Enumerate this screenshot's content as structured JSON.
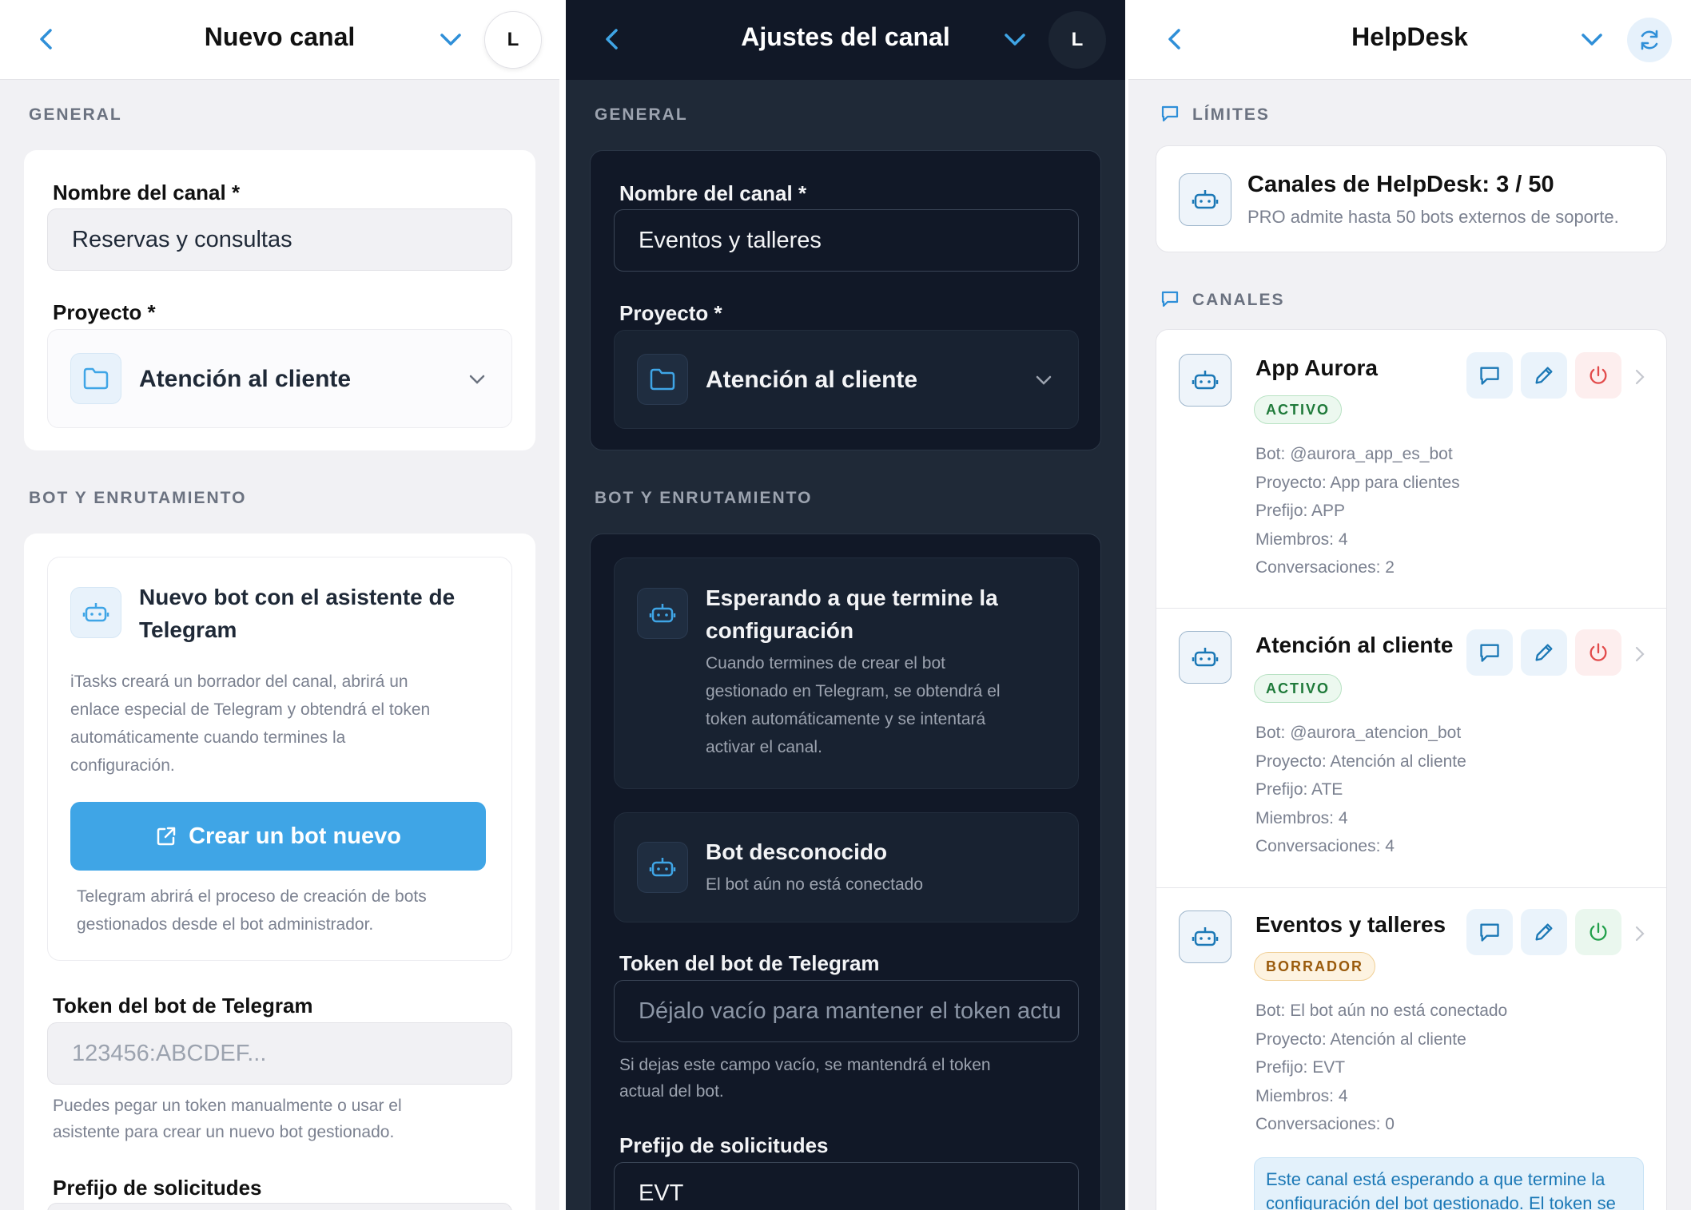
{
  "panel1": {
    "title": "Nuevo canal",
    "avatar": "L",
    "general_label": "GENERAL",
    "channel_name_label": "Nombre del canal *",
    "channel_name_value": "Reservas y consultas",
    "project_label": "Proyecto *",
    "project_value": "Atención al cliente",
    "bot_section_label": "BOT Y ENRUTAMIENTO",
    "wizard_title_line1": "Nuevo bot con el asistente de",
    "wizard_title_line2": "Telegram",
    "wizard_desc_lines": [
      "iTasks creará un borrador del canal, abrirá un",
      "enlace especial de Telegram y obtendrá el token",
      "automáticamente cuando termines la",
      "configuración."
    ],
    "create_button": "Crear un bot nuevo",
    "create_help_lines": [
      "Telegram abrirá el proceso de creación de bots",
      "gestionados desde el bot administrador."
    ],
    "token_label": "Token del bot de Telegram",
    "token_placeholder": "123456:ABCDEF...",
    "token_help_lines": [
      "Puedes pegar un token manualmente o usar el",
      "asistente para crear un nuevo bot gestionado."
    ],
    "prefix_label": "Prefijo de solicitudes"
  },
  "panel2": {
    "title": "Ajustes del canal",
    "avatar": "L",
    "general_label": "GENERAL",
    "channel_name_label": "Nombre del canal *",
    "channel_name_value": "Eventos y talleres",
    "project_label": "Proyecto *",
    "project_value": "Atención al cliente",
    "bot_section_label": "BOT Y ENRUTAMIENTO",
    "waiting_title_line1": "Esperando a que termine la",
    "waiting_title_line2": "configuración",
    "waiting_desc_lines": [
      "Cuando termines de crear el bot",
      "gestionado en Telegram, se obtendrá el",
      "token automáticamente y se intentará",
      "activar el canal."
    ],
    "unknown_bot_title": "Bot desconocido",
    "unknown_bot_desc": "El bot aún no está conectado",
    "token_label": "Token del bot de Telegram",
    "token_placeholder": "Déjalo vacío para mantener el token actu",
    "token_help_lines": [
      "Si dejas este campo vacío, se mantendrá el token",
      "actual del bot."
    ],
    "prefix_label": "Prefijo de solicitudes",
    "prefix_value": "EVT"
  },
  "panel3": {
    "title": "HelpDesk",
    "limits_label": "LÍMITES",
    "limit_title": "Canales de HelpDesk: 3 / 50",
    "limit_sub": "PRO admite hasta 50 bots externos de soporte.",
    "channels_label": "CANALES",
    "channels": [
      {
        "name": "App Aurora",
        "status": "ACTIVO",
        "bot": "Bot: @aurora_app_es_bot",
        "project": "Proyecto: App para clientes",
        "prefix": "Prefijo: APP",
        "members": "Miembros: 4",
        "conversations": "Conversaciones: 2"
      },
      {
        "name": "Atención al cliente",
        "status": "ACTIVO",
        "bot": "Bot: @aurora_atencion_bot",
        "project": "Proyecto: Atención al cliente",
        "prefix": "Prefijo: ATE",
        "members": "Miembros: 4",
        "conversations": "Conversaciones: 4"
      },
      {
        "name": "Eventos y talleres",
        "status": "BORRADOR",
        "bot": "Bot: El bot aún no está conectado",
        "project": "Proyecto: Atención al cliente",
        "prefix": "Prefijo: EVT",
        "members": "Miembros: 4",
        "conversations": "Conversaciones: 0"
      }
    ],
    "notice_lines": [
      "Este canal está esperando a que termine la",
      "configuración del bot gestionado. El token se"
    ]
  },
  "colors": {
    "accent": "#3fa5e6",
    "dark_bg": "#1f2937",
    "active_green": "#1f7a3a",
    "draft_orange": "#9a5b0d",
    "danger_red": "#e24b4b"
  },
  "icons": [
    "back-arrow-icon",
    "chevron-down-icon",
    "folder-icon",
    "bot-icon",
    "external-link-icon",
    "refresh-icon",
    "message-icon",
    "pencil-icon",
    "power-icon",
    "chevron-right-icon"
  ]
}
